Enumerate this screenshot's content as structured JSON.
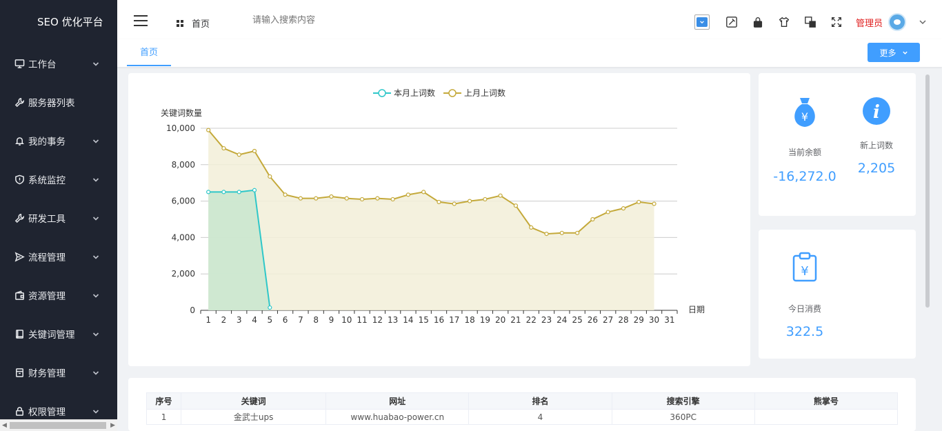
{
  "app": {
    "title": "SEO 优化平台"
  },
  "sidebar": {
    "items": [
      {
        "label": "工作台",
        "icon": "monitor-icon",
        "has_children": true
      },
      {
        "label": "服务器列表",
        "icon": "wrench-icon",
        "has_children": false
      },
      {
        "label": "我的事务",
        "icon": "bell-icon",
        "has_children": true
      },
      {
        "label": "系统监控",
        "icon": "shield-icon",
        "has_children": true
      },
      {
        "label": "研发工具",
        "icon": "wrench-icon",
        "has_children": true
      },
      {
        "label": "流程管理",
        "icon": "send-icon",
        "has_children": true
      },
      {
        "label": "资源管理",
        "icon": "wallet-icon",
        "has_children": true
      },
      {
        "label": "关键词管理",
        "icon": "book-icon",
        "has_children": true
      },
      {
        "label": "财务管理",
        "icon": "box-icon",
        "has_children": true
      },
      {
        "label": "权限管理",
        "icon": "lock-icon",
        "has_children": true
      }
    ]
  },
  "header": {
    "home_label": "首页",
    "search_placeholder": "请输入搜索内容",
    "user_name": "管理员"
  },
  "tabs": {
    "active_label": "首页",
    "more_label": "更多"
  },
  "chart_data": {
    "type": "area",
    "ylabel": "关键词数量",
    "xlabel": "日期",
    "ylim": [
      0,
      10000
    ],
    "yticks": [
      "0",
      "2,000",
      "4,000",
      "6,000",
      "8,000",
      "10,000"
    ],
    "x": [
      "1",
      "2",
      "3",
      "4",
      "5",
      "6",
      "7",
      "8",
      "9",
      "10",
      "11",
      "12",
      "13",
      "14",
      "15",
      "16",
      "17",
      "18",
      "19",
      "20",
      "21",
      "22",
      "23",
      "24",
      "25",
      "26",
      "27",
      "28",
      "29",
      "30",
      "31"
    ],
    "legend_position": "top-center",
    "series": [
      {
        "name": "本月上词数",
        "color": "#2ec7c9",
        "fill": "#c8e6cf",
        "values": [
          6500,
          6500,
          6500,
          6600,
          150
        ]
      },
      {
        "name": "上月上词数",
        "color": "#c4a93a",
        "fill": "#f2eed8",
        "values": [
          9900,
          8900,
          8550,
          8750,
          7350,
          6350,
          6150,
          6150,
          6250,
          6150,
          6100,
          6150,
          6100,
          6350,
          6500,
          5950,
          5850,
          6000,
          6100,
          6300,
          5750,
          4550,
          4200,
          4250,
          4250,
          5000,
          5400,
          5600,
          5950,
          5850
        ]
      }
    ]
  },
  "stats": {
    "balance_label": "当前余额",
    "balance_value": "-16,272.0",
    "new_keywords_label": "新上词数",
    "new_keywords_value": "2,205",
    "today_spend_label": "今日消费",
    "today_spend_value": "322.5"
  },
  "table": {
    "columns": [
      "序号",
      "关键词",
      "网址",
      "排名",
      "搜索引擎",
      "熊掌号"
    ],
    "rows": [
      [
        "1",
        "金武士ups",
        "www.huabao-power.cn",
        "4",
        "360PC",
        ""
      ]
    ]
  },
  "colors": {
    "accent": "#409eff",
    "sidebar_bg": "#1f2430",
    "admin_name": "#e02020"
  }
}
